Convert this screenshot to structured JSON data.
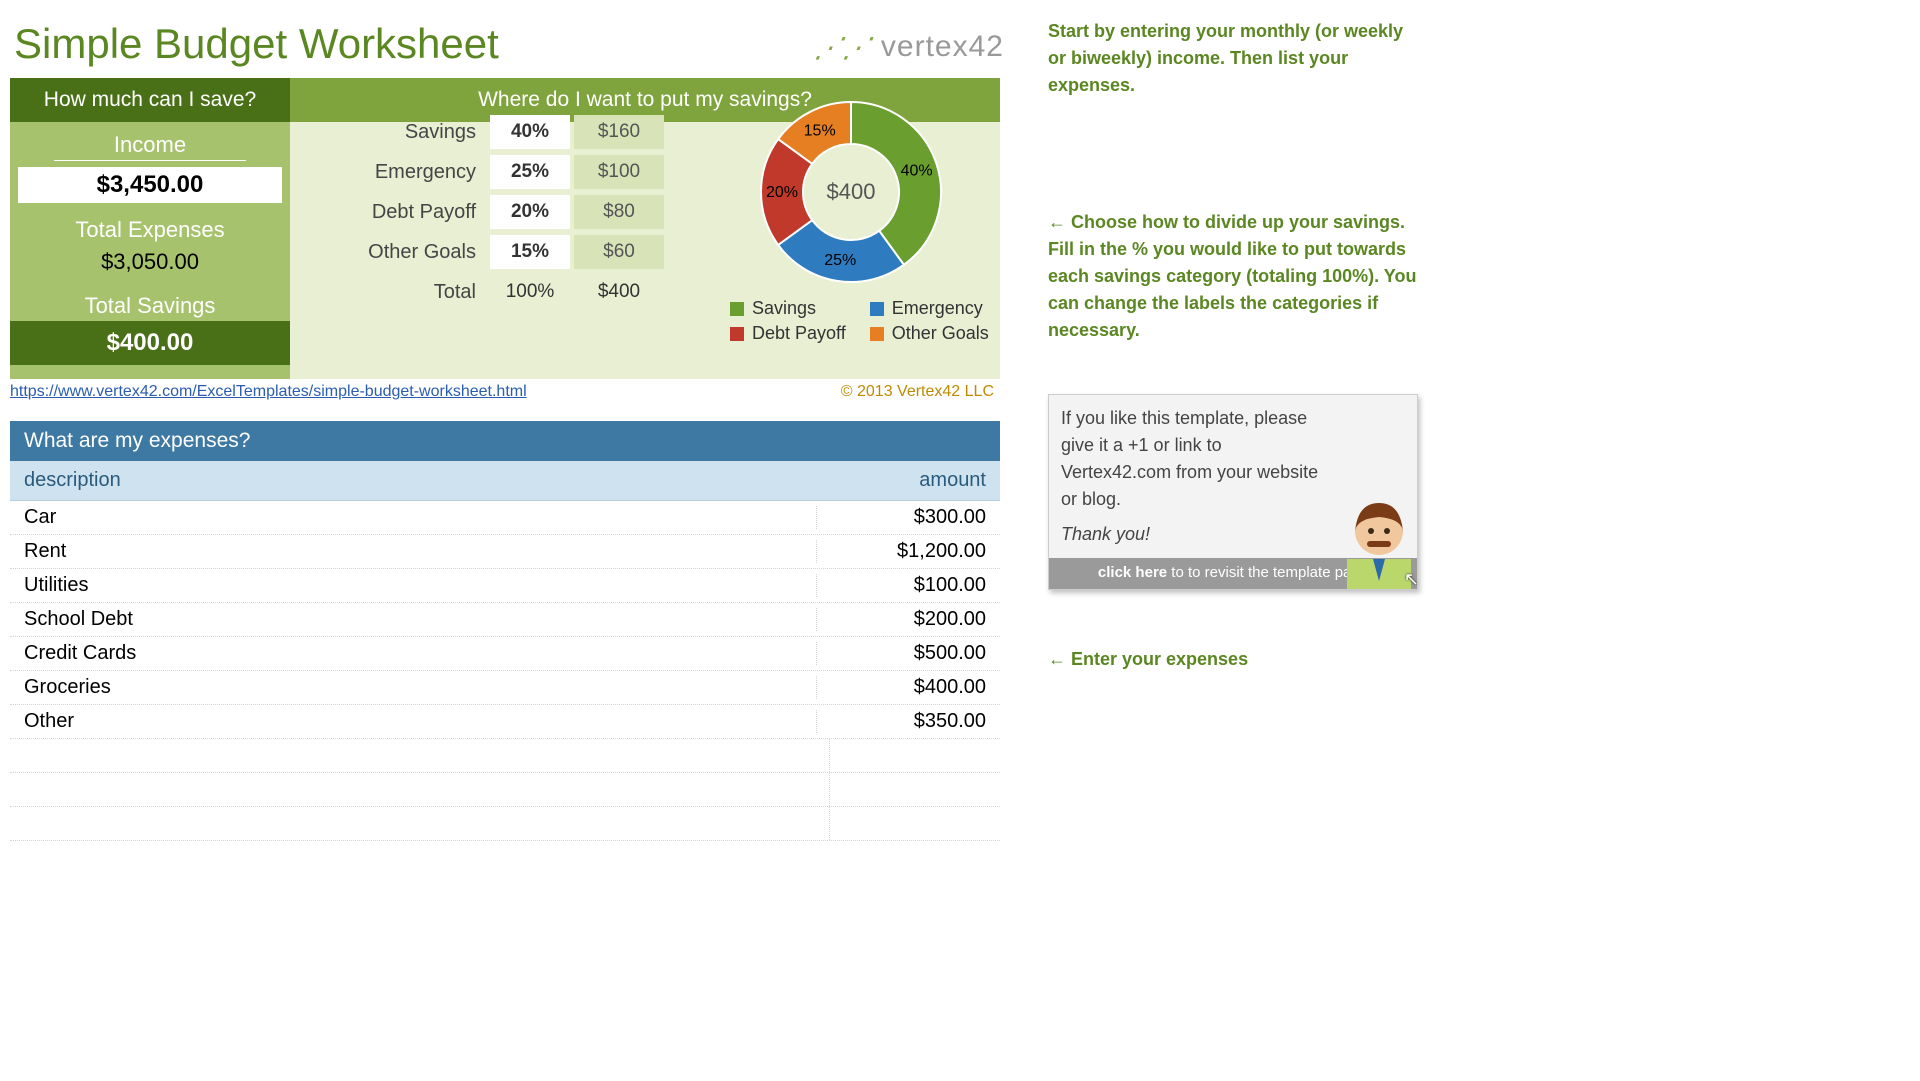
{
  "title": "Simple Budget Worksheet",
  "logo_text": "vertex42",
  "headers": {
    "save": "How much can I save?",
    "where": "Where do I want to put my savings?",
    "expenses": "What are my expenses?"
  },
  "summary": {
    "income_label": "Income",
    "income_value": "$3,450.00",
    "expenses_label": "Total Expenses",
    "expenses_value": "$3,050.00",
    "savings_label": "Total Savings",
    "savings_value": "$400.00"
  },
  "alloc": {
    "rows": [
      {
        "label": "Savings",
        "pct": "40%",
        "amt": "$160"
      },
      {
        "label": "Emergency",
        "pct": "25%",
        "amt": "$100"
      },
      {
        "label": "Debt Payoff",
        "pct": "20%",
        "amt": "$80"
      },
      {
        "label": "Other Goals",
        "pct": "15%",
        "amt": "$60"
      }
    ],
    "total_label": "Total",
    "total_pct": "100%",
    "total_amt": "$400"
  },
  "chart_data": {
    "type": "pie",
    "title": "",
    "center_label": "$400",
    "series": [
      {
        "name": "Savings",
        "value": 40,
        "color": "#6a9e2e",
        "label": "40%"
      },
      {
        "name": "Emergency",
        "value": 25,
        "color": "#2f7bbf",
        "label": "25%"
      },
      {
        "name": "Debt Payoff",
        "value": 20,
        "color": "#c0392b",
        "label": "20%"
      },
      {
        "name": "Other Goals",
        "value": 15,
        "color": "#e67e22",
        "label": "15%"
      }
    ]
  },
  "footer": {
    "link_text": "https://www.vertex42.com/ExcelTemplates/simple-budget-worksheet.html",
    "copyright": "© 2013 Vertex42 LLC"
  },
  "expense_cols": {
    "desc": "description",
    "amt": "amount"
  },
  "expenses": [
    {
      "desc": "Car",
      "amt": "$300.00"
    },
    {
      "desc": "Rent",
      "amt": "$1,200.00"
    },
    {
      "desc": "Utilities",
      "amt": "$100.00"
    },
    {
      "desc": "School Debt",
      "amt": "$200.00"
    },
    {
      "desc": "Credit Cards",
      "amt": "$500.00"
    },
    {
      "desc": "Groceries",
      "amt": "$400.00"
    },
    {
      "desc": "Other",
      "amt": "$350.00"
    }
  ],
  "side": {
    "note1": "Start by entering your monthly (or weekly or biweekly) income. Then list your expenses.",
    "note2": "← Choose how to divide up your savings. Fill in the % you would like to put towards each savings category (totaling 100%). You can change the labels the categories if necessary.",
    "promo_line1": "If you like this template, please give it a +1 or link to Vertex42.com from your website or blog.",
    "promo_thanks": "Thank you!",
    "promo_bar_bold": "click here",
    "promo_bar_rest": " to to revisit the template page",
    "note3": "← Enter your expenses"
  }
}
